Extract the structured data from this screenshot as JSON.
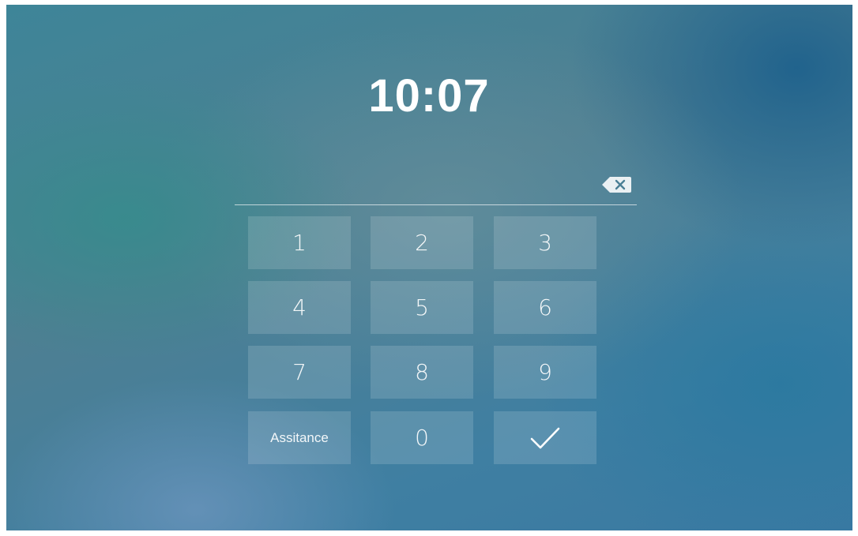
{
  "clock": {
    "time": "10:07"
  },
  "pin": {
    "value": ""
  },
  "keypad": {
    "keys": {
      "k1": "1",
      "k2": "2",
      "k3": "3",
      "k4": "4",
      "k5": "5",
      "k6": "6",
      "k7": "7",
      "k8": "8",
      "k9": "9",
      "assistance": "Assitance",
      "k0": "0"
    },
    "confirm_icon": "checkmark-icon",
    "backspace_icon": "backspace-icon"
  },
  "colors": {
    "text": "#ffffff",
    "key_background": "rgba(255,255,255,0.14)"
  }
}
